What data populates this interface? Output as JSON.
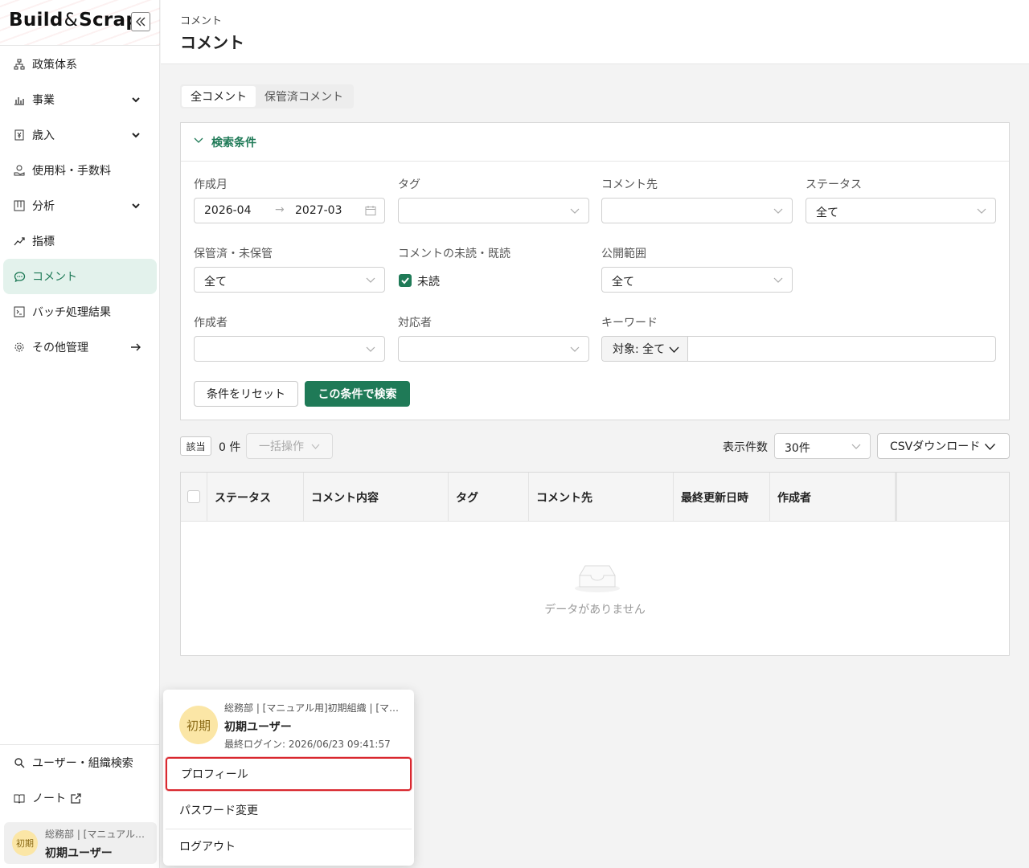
{
  "app": {
    "logo_main": "Build",
    "logo_amp": "&",
    "logo_tail": "Scrap",
    "collapse_icon": "double-chevron-left-icon"
  },
  "sidebar": {
    "items": [
      {
        "label": "政策体系",
        "icon": "hierarchy-icon",
        "has_chevron": false
      },
      {
        "label": "事業",
        "icon": "bar-chart-icon",
        "has_chevron": true
      },
      {
        "label": "歳入",
        "icon": "yen-receipt-icon",
        "has_chevron": true
      },
      {
        "label": "使用料・手数料",
        "icon": "coin-hand-icon",
        "has_chevron": false
      },
      {
        "label": "分析",
        "icon": "analysis-board-icon",
        "has_chevron": true
      },
      {
        "label": "指標",
        "icon": "trend-line-icon",
        "has_chevron": false
      },
      {
        "label": "コメント",
        "icon": "comment-icon",
        "has_chevron": false,
        "active": true
      },
      {
        "label": "バッチ処理結果",
        "icon": "terminal-icon",
        "has_chevron": false
      },
      {
        "label": "その他管理",
        "icon": "gear-icon",
        "has_arrow": true
      }
    ],
    "bottom": {
      "user_search": "ユーザー・組織検索",
      "note": "ノート"
    },
    "user_card": {
      "avatar": "初期",
      "org": "総務部 | [マニュアル…",
      "name": "初期ユーザー"
    }
  },
  "header": {
    "breadcrumb": "コメント",
    "title": "コメント"
  },
  "tabs": [
    {
      "label": "全コメント",
      "selected": true
    },
    {
      "label": "保管済コメント",
      "selected": false
    }
  ],
  "search": {
    "title": "検索条件",
    "created_month_label": "作成月",
    "date_from": "2026-04",
    "date_to": "2027-03",
    "tag_label": "タグ",
    "tag_value": "",
    "target_label": "コメント先",
    "target_value": "",
    "status_label": "ステータス",
    "status_value": "全て",
    "archived_label": "保管済・未保管",
    "archived_value": "全て",
    "read_label": "コメントの未読・既読",
    "unread_checkbox": "未読",
    "unread_checked": true,
    "visibility_label": "公開範囲",
    "visibility_value": "全て",
    "author_label": "作成者",
    "author_value": "",
    "assignee_label": "対応者",
    "assignee_value": "",
    "keyword_label": "キーワード",
    "keyword_target": "対象: 全て",
    "keyword_value": "",
    "reset_button": "条件をリセット",
    "search_button": "この条件で検索"
  },
  "results": {
    "count_badge": "該当",
    "count_text": "0 件",
    "bulk_action": "一括操作",
    "per_page_label": "表示件数",
    "per_page_value": "30件",
    "csv_button": "CSVダウンロード",
    "columns": [
      "ステータス",
      "コメント内容",
      "タグ",
      "コメント先",
      "最終更新日時",
      "作成者"
    ],
    "empty_text": "データがありません"
  },
  "user_popup": {
    "avatar": "初期",
    "org": "総務部 | [マニュアル用]初期組織 | [マ…",
    "name": "初期ユーザー",
    "last_login": "最終ログイン: 2026/06/23 09:41:57",
    "profile": "プロフィール",
    "password_change": "パスワード変更",
    "logout": "ログアウト"
  },
  "colors": {
    "accent": "#1f7a57",
    "active_bg": "#e3f2ec",
    "highlight_border": "#d9282f",
    "avatar_bg": "#fbe6a6"
  }
}
